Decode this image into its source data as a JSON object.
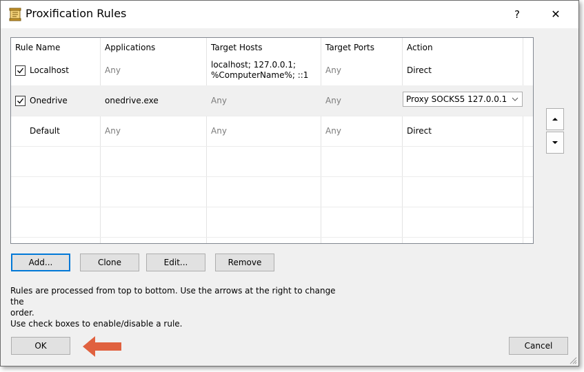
{
  "window": {
    "title": "Proxification Rules",
    "help_glyph": "?",
    "close_glyph": "✕"
  },
  "grid": {
    "columns": [
      "Rule Name",
      "Applications",
      "Target Hosts",
      "Target Ports",
      "Action"
    ],
    "rows": [
      {
        "name": "Localhost",
        "checked": true,
        "applications": "Any",
        "hosts_line1": "localhost; 127.0.0.1;",
        "hosts_line2": "%ComputerName%; ::1",
        "ports": "Any",
        "action": "Direct"
      },
      {
        "name": "Onedrive",
        "checked": true,
        "applications": "onedrive.exe",
        "hosts": "Any",
        "ports": "Any",
        "action": "Proxy SOCKS5 127.0.0.1"
      },
      {
        "name": "Default",
        "applications": "Any",
        "hosts": "Any",
        "ports": "Any",
        "action": "Direct"
      }
    ]
  },
  "buttons": {
    "add": "Add...",
    "clone": "Clone",
    "edit": "Edit...",
    "remove": "Remove",
    "ok": "OK",
    "cancel": "Cancel"
  },
  "notes": {
    "line1": "Rules are processed from top to bottom. Use the arrows at the right to change the",
    "line2": "order.",
    "line3": "Use check boxes to enable/disable a rule."
  },
  "colors": {
    "accent": "#0078d7",
    "pointer_arrow": "#e0613f",
    "dialog_bg": "#f0f0f0"
  },
  "icons": [
    "app-scroll-icon",
    "help-icon",
    "close-icon",
    "checkbox-checked-icon",
    "chevron-down-icon",
    "arrow-up-icon",
    "arrow-down-icon",
    "red-pointer-arrow",
    "resize-grip-icon"
  ]
}
